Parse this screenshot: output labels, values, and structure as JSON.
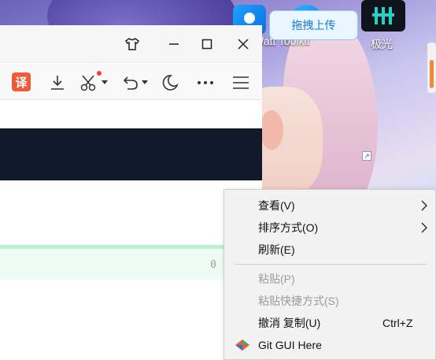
{
  "desktop": {
    "upload_button": "拖拽上传",
    "watt_label": "Watt Toolkit",
    "jiguang_label": "极光"
  },
  "browser": {
    "toolbar": {
      "translate_label": "译"
    },
    "line_count": "0"
  },
  "context_menu": {
    "items": [
      {
        "label": "查看(V)",
        "submenu": true
      },
      {
        "label": "排序方式(O)",
        "submenu": true
      },
      {
        "label": "刷新(E)"
      },
      {
        "label": "粘贴(P)",
        "disabled": true
      },
      {
        "label": "粘贴快捷方式(S)",
        "disabled": true
      },
      {
        "label": "撤消 复制(U)",
        "shortcut": "Ctrl+Z"
      },
      {
        "label": "Git GUI Here"
      }
    ]
  },
  "colors": {
    "accent_orange": "#f08a34",
    "dark_band": "#101a2b",
    "translate_red": "#ef5b3a"
  }
}
